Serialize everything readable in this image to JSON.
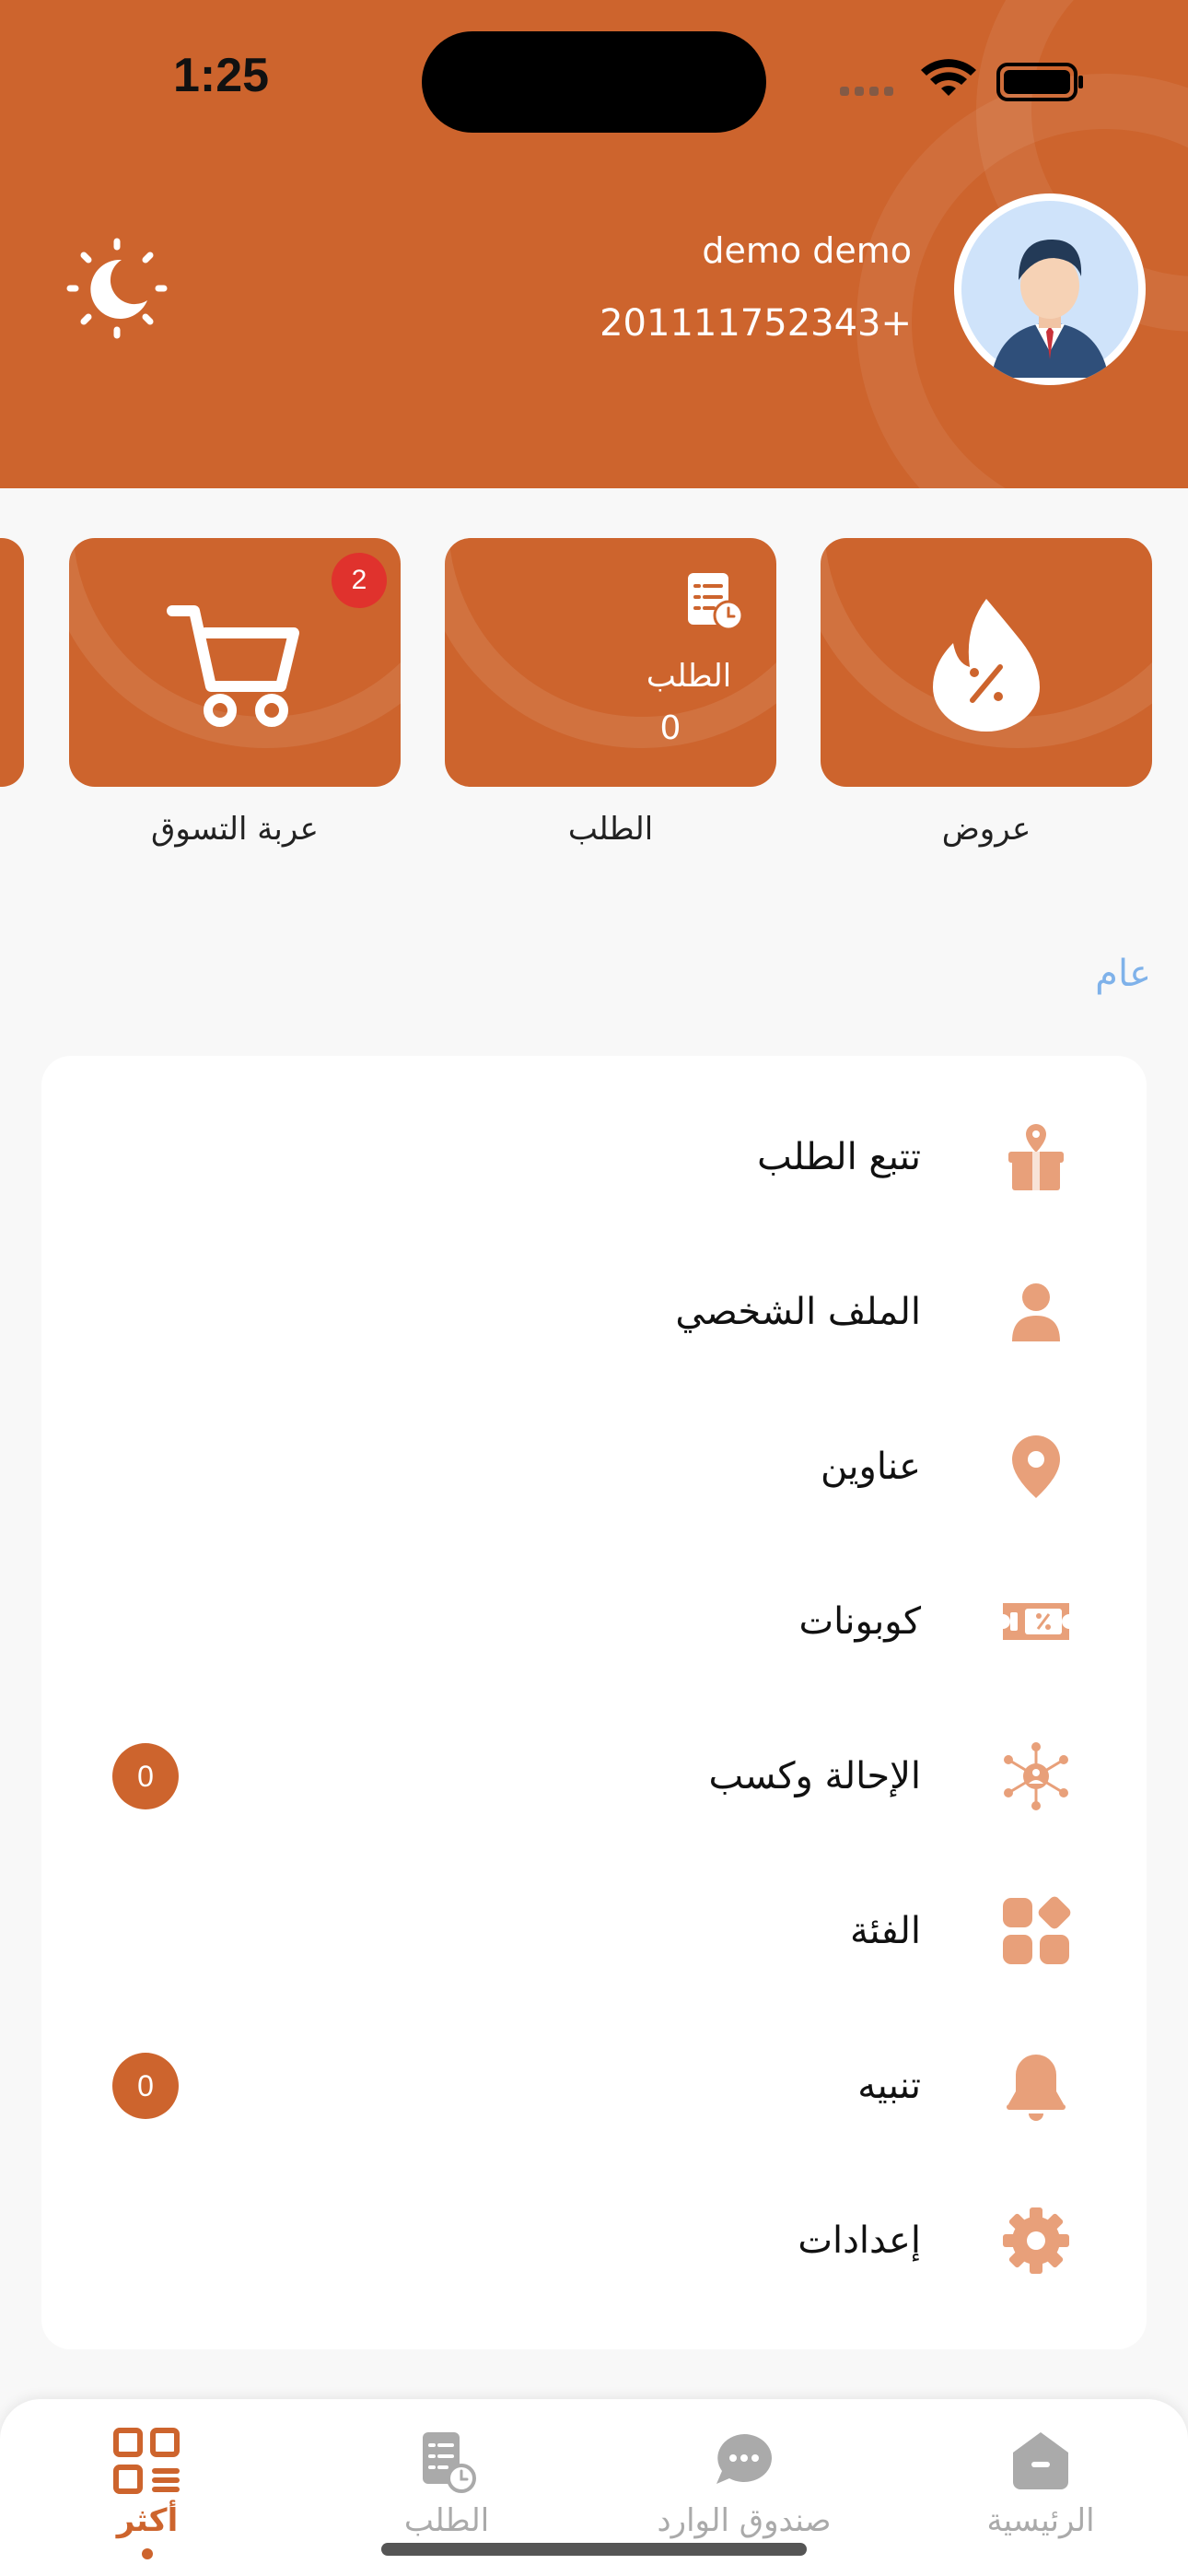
{
  "status_bar": {
    "time": "1:25"
  },
  "user": {
    "name": "demo demo",
    "phone": "201111752343+"
  },
  "quick_actions": [
    {
      "name": "offers",
      "label": "عروض"
    },
    {
      "name": "orders",
      "label": "الطلب",
      "inner_title": "الطلب",
      "inner_count": "0"
    },
    {
      "name": "cart",
      "label": "عربة التسوق",
      "badge": "2"
    }
  ],
  "section": {
    "title": "عام"
  },
  "menu": [
    {
      "id": "track-order",
      "label": "تتبع الطلب",
      "icon": "package-location-icon"
    },
    {
      "id": "profile",
      "label": "الملف الشخصي",
      "icon": "user-icon"
    },
    {
      "id": "addresses",
      "label": "عناوين",
      "icon": "map-pin-icon"
    },
    {
      "id": "coupons",
      "label": "كوبونات",
      "icon": "coupon-icon"
    },
    {
      "id": "refer-earn",
      "label": "الإحالة وكسب",
      "icon": "network-icon",
      "count": "0"
    },
    {
      "id": "category",
      "label": "الفئة",
      "icon": "grid-icon"
    },
    {
      "id": "notification",
      "label": "تنبيه",
      "icon": "bell-icon",
      "count": "0"
    },
    {
      "id": "settings",
      "label": "إعدادات",
      "icon": "gear-icon"
    }
  ],
  "bottom_nav": [
    {
      "id": "more",
      "label": "أكثر",
      "active": true
    },
    {
      "id": "orders",
      "label": "الطلب"
    },
    {
      "id": "inbox",
      "label": "صندوق الوارد"
    },
    {
      "id": "home",
      "label": "الرئيسية"
    }
  ],
  "colors": {
    "primary": "#cd642d",
    "icon_tint": "#e8a07a",
    "badge_red": "#e0322d",
    "section_blue": "#7fb2ea"
  }
}
